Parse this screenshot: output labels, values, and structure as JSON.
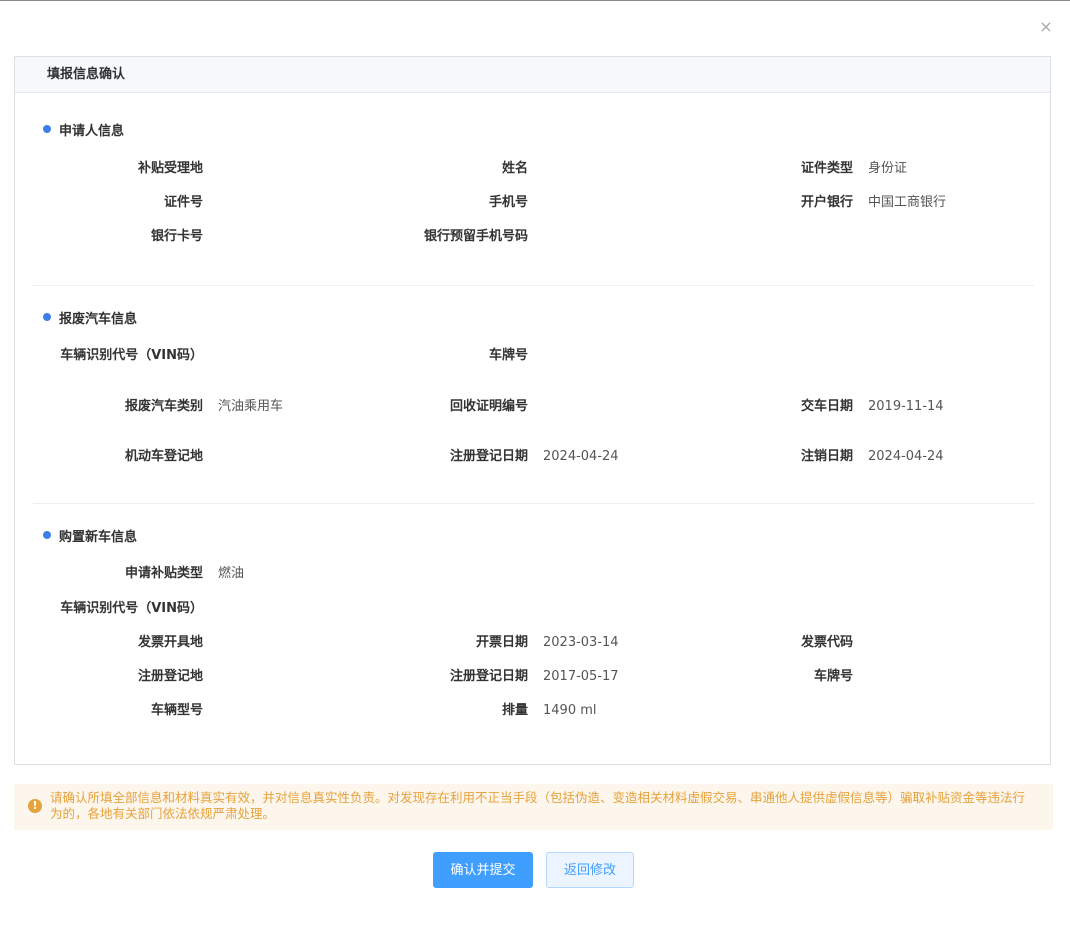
{
  "dialog": {
    "close_glyph": "×"
  },
  "card": {
    "title": "填报信息确认"
  },
  "applicant": {
    "title": "申请人信息",
    "fields": {
      "subsidy_place": {
        "label": "补贴受理地",
        "value": ""
      },
      "name": {
        "label": "姓名",
        "value": ""
      },
      "id_type": {
        "label": "证件类型",
        "value": "身份证"
      },
      "id_number": {
        "label": "证件号",
        "value": ""
      },
      "phone": {
        "label": "手机号",
        "value": ""
      },
      "bank": {
        "label": "开户银行",
        "value": "中国工商银行"
      },
      "bank_card": {
        "label": "银行卡号",
        "value": ""
      },
      "bank_phone": {
        "label": "银行预留手机号码",
        "value": ""
      }
    }
  },
  "scrap_car": {
    "title": "报废汽车信息",
    "fields": {
      "vin": {
        "label": "车辆识别代号（VIN码）",
        "value": ""
      },
      "plate": {
        "label": "车牌号",
        "value": ""
      },
      "category": {
        "label": "报废汽车类别",
        "value": "汽油乘用车"
      },
      "recycle_cert": {
        "label": "回收证明编号",
        "value": ""
      },
      "handover_date": {
        "label": "交车日期",
        "value": "2019-11-14"
      },
      "register_place": {
        "label": "机动车登记地",
        "value": ""
      },
      "register_date": {
        "label": "注册登记日期",
        "value": "2024-04-24"
      },
      "cancel_date": {
        "label": "注销日期",
        "value": "2024-04-24"
      }
    }
  },
  "new_car": {
    "title": "购置新车信息",
    "fields": {
      "subsidy_type": {
        "label": "申请补贴类型",
        "value": "燃油"
      },
      "vin": {
        "label": "车辆识别代号（VIN码）",
        "value": ""
      },
      "invoice_place": {
        "label": "发票开具地",
        "value": ""
      },
      "invoice_date": {
        "label": "开票日期",
        "value": "2023-03-14"
      },
      "invoice_code": {
        "label": "发票代码",
        "value": ""
      },
      "register_place": {
        "label": "注册登记地",
        "value": ""
      },
      "register_date": {
        "label": "注册登记日期",
        "value": "2017-05-17"
      },
      "plate": {
        "label": "车牌号",
        "value": ""
      },
      "model": {
        "label": "车辆型号",
        "value": ""
      },
      "displacement": {
        "label": "排量",
        "value": "1490 ml"
      }
    }
  },
  "notice": {
    "icon": "warning-icon",
    "icon_glyph": "!",
    "text": "请确认所填全部信息和材料真实有效，并对信息真实性负责。对发现存在利用不正当手段（包括伪造、变造相关材料虚假交易、串通他人提供虚假信息等）骗取补贴资金等违法行为的，各地有关部门依法依规严肃处理。"
  },
  "actions": {
    "confirm": "确认并提交",
    "back": "返回修改"
  },
  "colors": {
    "primary": "#409eff",
    "dot": "#3e7ee8",
    "warning": "#e6a23c",
    "notice_bg": "#fdf6ec"
  }
}
